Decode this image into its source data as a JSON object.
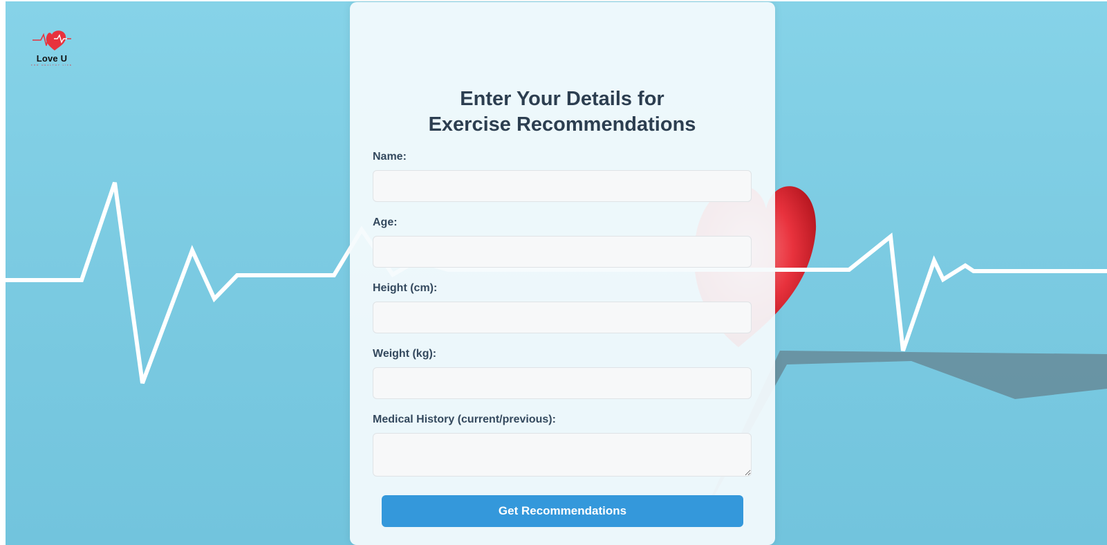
{
  "brand": {
    "name": "Love U",
    "tagline": "FOR HEALTHY LIFE",
    "accent_color": "#e8323d",
    "logo_icon": "heart-pulse-icon"
  },
  "form": {
    "title": "Enter Your Details for Exercise Recommendations",
    "fields": [
      {
        "label": "Name:",
        "value": "",
        "type": "text"
      },
      {
        "label": "Age:",
        "value": "",
        "type": "number"
      },
      {
        "label": "Height (cm):",
        "value": "",
        "type": "number"
      },
      {
        "label": "Weight (kg):",
        "value": "",
        "type": "number"
      },
      {
        "label": "Medical History (current/previous):",
        "value": "",
        "type": "textarea"
      }
    ],
    "submit_label": "Get Recommendations",
    "submit_color": "#3498db"
  },
  "background": {
    "theme": "heartbeat-line-with-heart",
    "color": "#7ccbe2"
  }
}
